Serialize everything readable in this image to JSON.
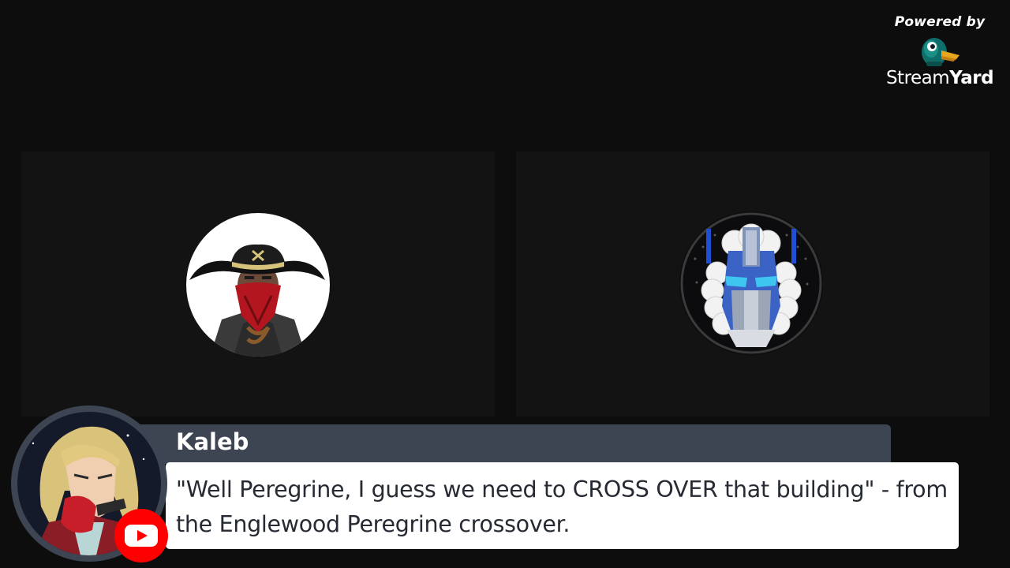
{
  "branding": {
    "powered_by": "Powered by",
    "brand_part1": "Stream",
    "brand_part2": "Yard",
    "logo_icon": "duck-logo-icon"
  },
  "participants": [
    {
      "avatar_icon": "cowboy-masked-avatar",
      "background": "#131314"
    },
    {
      "avatar_icon": "robot-judge-avatar",
      "background": "#131314"
    }
  ],
  "comment": {
    "author": "Kaleb",
    "text": "\"Well Peregrine, I guess we need to CROSS OVER that building\" - from the Englewood Peregrine crossover.",
    "platform_icon": "youtube-icon",
    "avatar_icon": "anime-character-avatar",
    "name_bar_color": "#3d4553",
    "platform_color": "#ff0000"
  }
}
